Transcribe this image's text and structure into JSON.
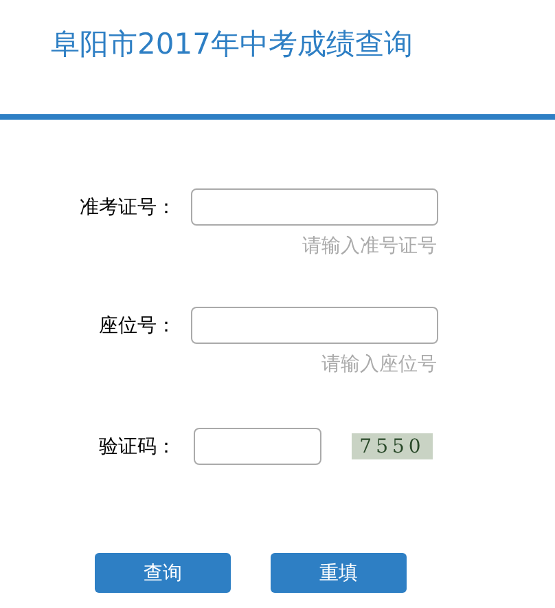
{
  "title": "阜阳市2017年中考成绩查询",
  "fields": [
    {
      "label": "准考证号：",
      "hint": "请输入准号证号"
    },
    {
      "label": "座位号：",
      "hint": "请输入座位号"
    }
  ],
  "captcha": {
    "label": "验证码：",
    "code": "7550"
  },
  "buttons": [
    "查询",
    "重填"
  ]
}
